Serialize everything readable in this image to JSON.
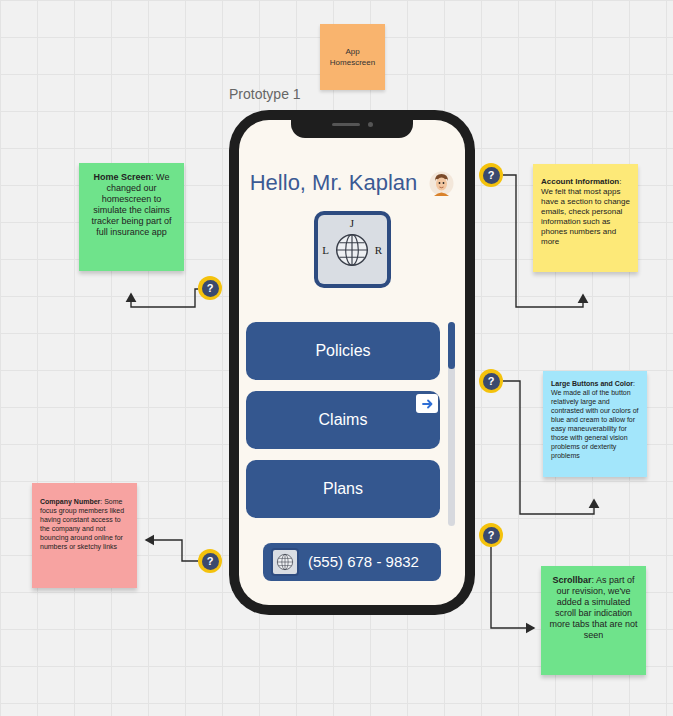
{
  "board": {
    "title_note": "App Homescreen",
    "frame_label": "Prototype 1"
  },
  "phone": {
    "greeting": "Hello, Mr. Kaplan",
    "logo_letters": [
      "J",
      "L",
      "R"
    ],
    "menu": [
      {
        "label": "Policies",
        "has_arrow": false
      },
      {
        "label": "Claims",
        "has_arrow": true
      },
      {
        "label": "Plans",
        "has_arrow": false
      }
    ],
    "scrollbar": {
      "level": 0.23
    },
    "phone_number": "(555) 678 - 9832"
  },
  "notes": [
    {
      "title": "Home Screen",
      "body": ": We changed our homescreen to simulate the claims tracker being part of full insurance app",
      "color": "#6fe38b"
    },
    {
      "title": "Account Information",
      "body": ": We felt that most apps have a section to change emails, check personal information such as phones numbers and more",
      "color": "#fde978"
    },
    {
      "title": "Large Buttons and Color",
      "body": ": We made all of the button relatively large and contrasted with our colors of blue and cream to allow for easy maneuverability for those with general vision problems or dexterity problems",
      "color": "#a3e6fb"
    },
    {
      "title": "Company Number",
      "body": ": Some focus group members liked having constant access to the company and not bouncing around online for numbers or sketchy links",
      "color": "#f7a3a1"
    },
    {
      "title": "Scrollbar",
      "body": ": As part of our revision, we've added a simulated scroll bar indication more tabs that are not seen",
      "color": "#6fe38b"
    }
  ],
  "badges": [
    {
      "label": "?"
    },
    {
      "label": "?"
    },
    {
      "label": "?"
    },
    {
      "label": "?"
    },
    {
      "label": "?"
    }
  ]
}
